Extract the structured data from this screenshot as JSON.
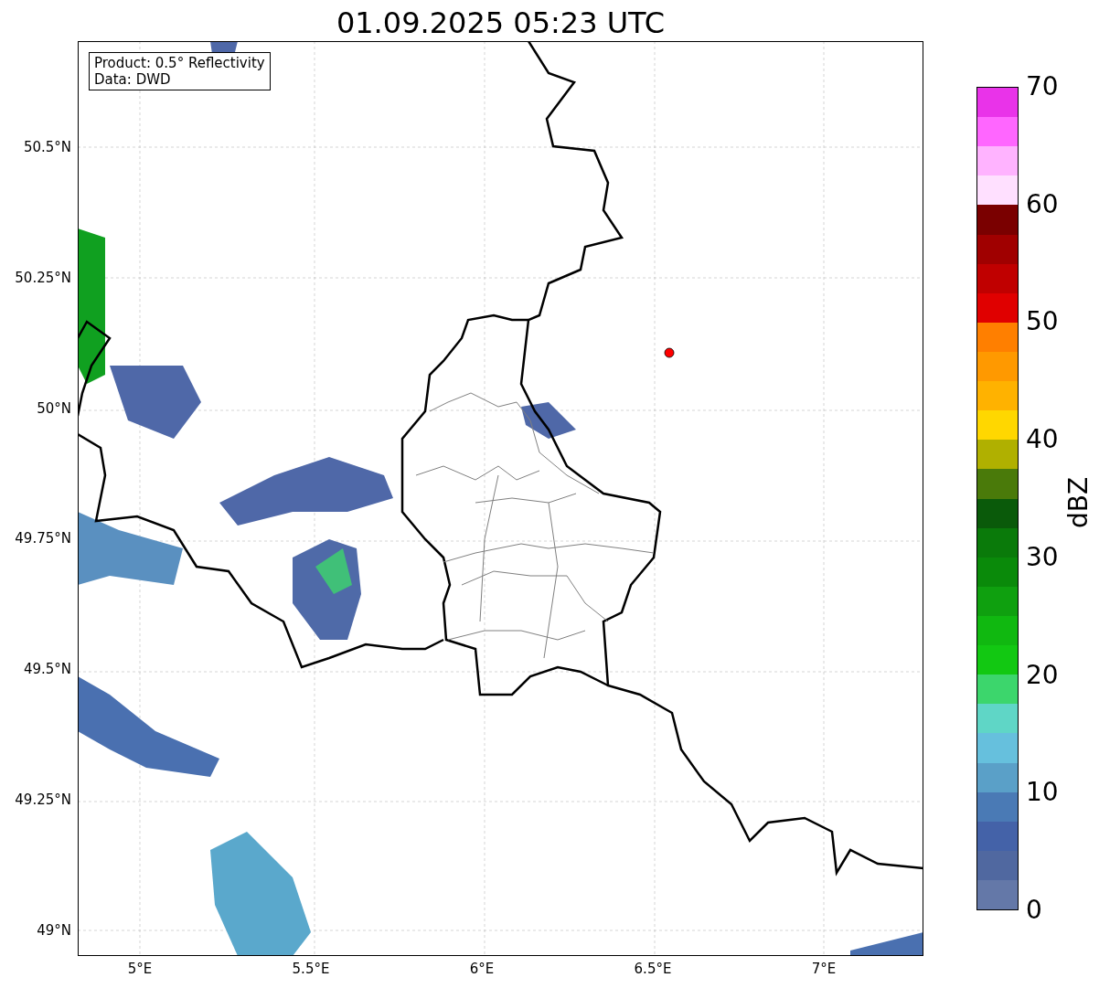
{
  "title": "01.09.2025 05:23 UTC",
  "map": {
    "info_box": [
      "Product: 0.5° Reflectivity",
      "Data: DWD"
    ],
    "lat_labels": [
      "50.5°N",
      "50.25°N",
      "50°N",
      "49.75°N",
      "49.5°N",
      "49.25°N",
      "49°N"
    ],
    "lon_labels": [
      "5°E",
      "5.5°E",
      "6°E",
      "6.5°E",
      "7°E"
    ]
  },
  "colorbar": {
    "label": "dBZ",
    "ticks": [
      "70",
      "60",
      "50",
      "40",
      "30",
      "20",
      "10",
      "0"
    ],
    "segments": [
      {
        "color": "#6478a8"
      },
      {
        "color": "#5068a0"
      },
      {
        "color": "#4462a8"
      },
      {
        "color": "#4a7ab5"
      },
      {
        "color": "#5aa0c8"
      },
      {
        "color": "#66c0dd"
      },
      {
        "color": "#5fd6c6"
      },
      {
        "color": "#3cd66c"
      },
      {
        "color": "#12c812"
      },
      {
        "color": "#10b810"
      },
      {
        "color": "#0fa00f"
      },
      {
        "color": "#0a8a0a"
      },
      {
        "color": "#0a7a0a"
      },
      {
        "color": "#0a5a0a"
      },
      {
        "color": "#4a7a0a"
      },
      {
        "color": "#b0b000"
      },
      {
        "color": "#ffd700"
      },
      {
        "color": "#ffb200"
      },
      {
        "color": "#ff9900"
      },
      {
        "color": "#ff7f00"
      },
      {
        "color": "#e00000"
      },
      {
        "color": "#c00000"
      },
      {
        "color": "#a00000"
      },
      {
        "color": "#7a0000"
      },
      {
        "color": "#ffe0ff"
      },
      {
        "color": "#ffb3ff"
      },
      {
        "color": "#ff66ff"
      },
      {
        "color": "#e933e9"
      }
    ]
  }
}
